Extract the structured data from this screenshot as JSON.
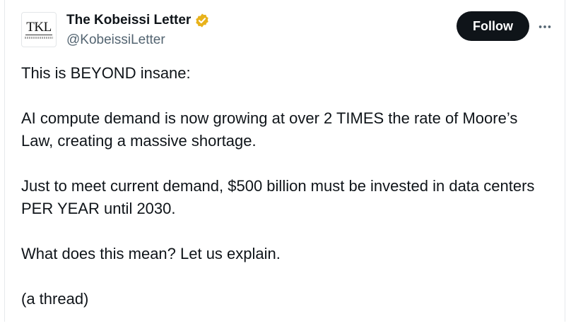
{
  "author": {
    "display_name": "The Kobeissi Letter",
    "handle": "@KobeissiLetter",
    "avatar_text": "TKL",
    "verified_icon": "verified-badge-icon",
    "verified_color": "#e8b21b"
  },
  "actions": {
    "follow_label": "Follow",
    "more_icon": "more-horizontal-icon"
  },
  "tweet": {
    "paragraphs": [
      "This is BEYOND insane:",
      "AI compute demand is now growing at over 2 TIMES the rate of Moore’s Law, creating a massive shortage.",
      "Just to meet current demand, $500 billion must be invested in data centers PER YEAR until 2030.",
      "What does this mean? Let us explain.",
      "(a thread)"
    ]
  },
  "colors": {
    "text": "#0f1419",
    "secondary_text": "#536471",
    "follow_button_bg": "#0f1419",
    "follow_button_text": "#ffffff"
  }
}
